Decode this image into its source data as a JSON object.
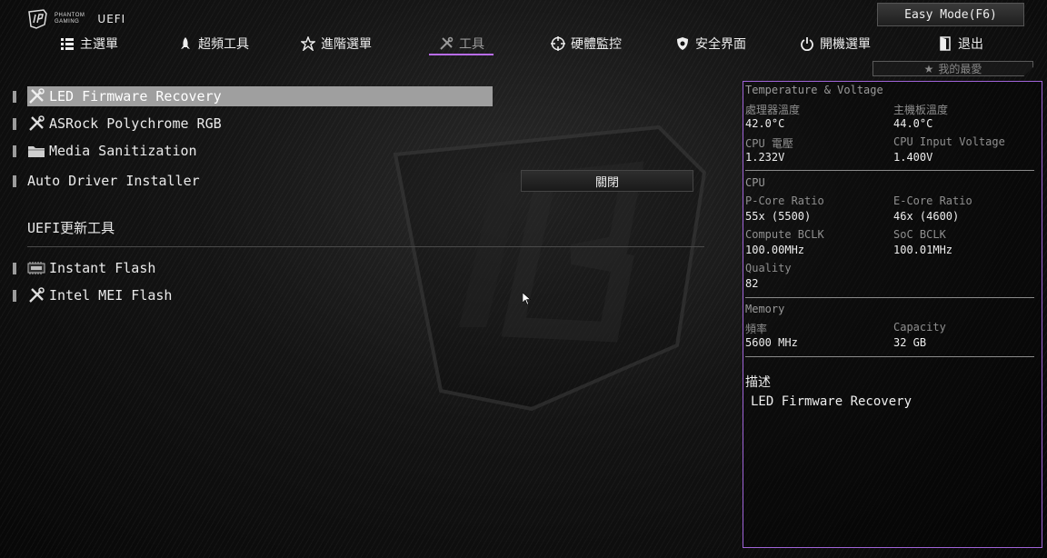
{
  "brand": {
    "line1": "PHANTOM",
    "line2": "GAMING",
    "uefi": "UEFI"
  },
  "easy_mode": "Easy Mode(F6)",
  "nav": {
    "tabs": [
      {
        "label": "主選單",
        "icon": "list-icon"
      },
      {
        "label": "超頻工具",
        "icon": "rocket-icon"
      },
      {
        "label": "進階選單",
        "icon": "star-icon"
      },
      {
        "label": "工具",
        "icon": "tools-icon",
        "active": true
      },
      {
        "label": "硬體監控",
        "icon": "crosshair-icon"
      },
      {
        "label": "安全界面",
        "icon": "shield-icon"
      },
      {
        "label": "開機選單",
        "icon": "power-icon"
      },
      {
        "label": "退出",
        "icon": "exit-icon"
      }
    ],
    "active_color": "#b96cf0"
  },
  "favorites": "我的最愛",
  "menu": {
    "items": [
      {
        "label": "LED Firmware Recovery",
        "icon": "tools-icon",
        "selected": true
      },
      {
        "label": "ASRock Polychrome RGB",
        "icon": "tools-icon"
      },
      {
        "label": "Media Sanitization",
        "icon": "folder-icon"
      },
      {
        "label": "Auto Driver Installer",
        "value": "關閉"
      }
    ],
    "section_title": "UEFI更新工具",
    "update_items": [
      {
        "label": "Instant Flash",
        "icon": "bios-icon"
      },
      {
        "label": "Intel MEI Flash",
        "icon": "tools-icon"
      }
    ]
  },
  "monitor": {
    "temp_voltage": {
      "title": "Temperature & Voltage",
      "cpu_temp_label": "處理器溫度",
      "cpu_temp": "42.0°C",
      "mb_temp_label": "主機板溫度",
      "mb_temp": "44.0°C",
      "cpu_volt_label": "CPU 電壓",
      "cpu_volt": "1.232V",
      "cpu_input_label": "CPU Input Voltage",
      "cpu_input": "1.400V"
    },
    "cpu": {
      "title": "CPU",
      "pcore_label": "P-Core Ratio",
      "pcore": "55x (5500)",
      "ecore_label": "E-Core Ratio",
      "ecore": "46x (4600)",
      "bclk_label": "Compute BCLK",
      "bclk": "100.00MHz",
      "soc_label": "SoC BCLK",
      "soc": "100.01MHz",
      "quality_label": "Quality",
      "quality": "82"
    },
    "memory": {
      "title": "Memory",
      "freq_label": "頻率",
      "freq": "5600 MHz",
      "cap_label": "Capacity",
      "cap": "32 GB"
    },
    "description": {
      "title": "描述",
      "text": "LED Firmware Recovery"
    },
    "border_color": "#a064d8"
  }
}
